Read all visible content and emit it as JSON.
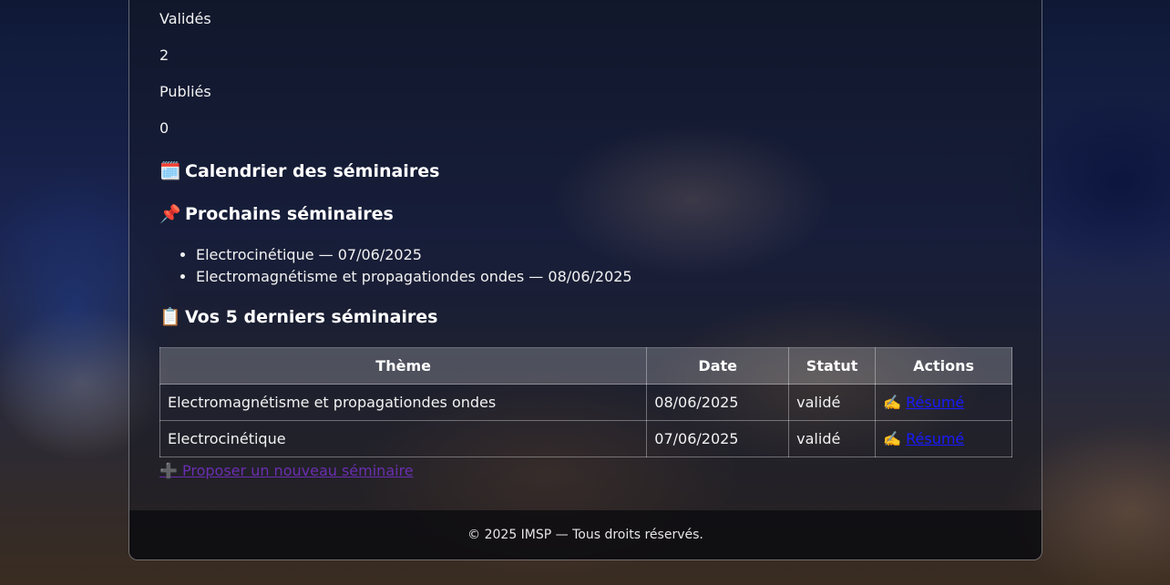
{
  "stats": [
    {
      "label": "Validés",
      "value": "2"
    },
    {
      "label": "Publiés",
      "value": "0"
    }
  ],
  "sections": {
    "calendar": {
      "icon": "🗓️",
      "title": "Calendrier des séminaires"
    },
    "upcoming": {
      "icon": "📌",
      "title": "Prochains séminaires"
    },
    "recent": {
      "icon": "📋",
      "title": "Vos 5 derniers séminaires"
    }
  },
  "upcoming_items": [
    "Electrocinétique — 07/06/2025",
    "Electromagnétisme et propagationdes ondes — 08/06/2025"
  ],
  "table": {
    "headers": [
      "Thème",
      "Date",
      "Statut",
      "Actions"
    ],
    "rows": [
      {
        "theme": "Electromagnétisme et propagationdes ondes",
        "date": "08/06/2025",
        "status": "validé",
        "action_icon": "✍️",
        "action_label": "Résumé"
      },
      {
        "theme": "Electrocinétique",
        "date": "07/06/2025",
        "status": "validé",
        "action_icon": "✍️",
        "action_label": "Résumé"
      }
    ]
  },
  "propose": {
    "icon": "➕",
    "label": "Proposer un nouveau séminaire"
  },
  "footer": {
    "text": "© 2025 IMSP — Tous droits réservés."
  },
  "colors": {
    "link": "#1a1aff",
    "visited_link": "#6a2fb0"
  }
}
